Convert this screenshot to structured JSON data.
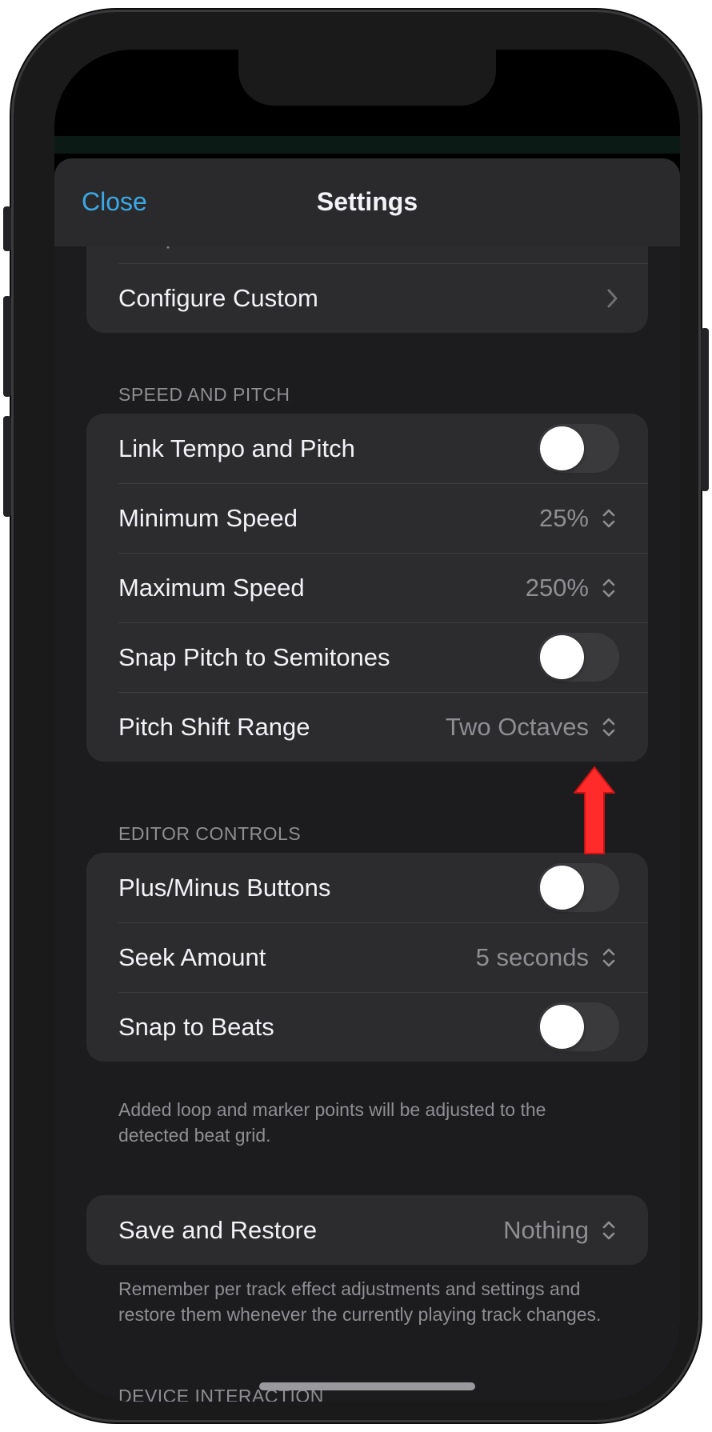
{
  "nav": {
    "close_label": "Close",
    "title": "Settings"
  },
  "top_group": {
    "partial_text": "Tempo, Pitch, Mono, Balance",
    "configure_label": "Configure Custom"
  },
  "speed_pitch": {
    "header": "SPEED AND PITCH",
    "rows": [
      {
        "label": "Link Tempo and Pitch",
        "kind": "toggle",
        "on": false
      },
      {
        "label": "Minimum Speed",
        "kind": "picker",
        "value": "25%"
      },
      {
        "label": "Maximum Speed",
        "kind": "picker",
        "value": "250%"
      },
      {
        "label": "Snap Pitch to Semitones",
        "kind": "toggle",
        "on": false
      },
      {
        "label": "Pitch Shift Range",
        "kind": "picker",
        "value": "Two Octaves"
      }
    ]
  },
  "editor_controls": {
    "header": "EDITOR CONTROLS",
    "rows": [
      {
        "label": "Plus/Minus Buttons",
        "kind": "toggle",
        "on": false
      },
      {
        "label": "Seek Amount",
        "kind": "picker",
        "value": "5 seconds"
      },
      {
        "label": "Snap to Beats",
        "kind": "toggle",
        "on": false
      }
    ],
    "footer": "Added loop and marker points will be adjusted to the detected beat grid."
  },
  "save_restore": {
    "label": "Save and Restore",
    "value": "Nothing",
    "footer": "Remember per track effect adjustments and settings and restore them whenever the currently playing track changes."
  },
  "next_section_partial": "DEVICE INTERACTION",
  "colors": {
    "accent": "#3aa9e6",
    "sheet_background": "#1c1c1e",
    "group_background": "#2c2c2e",
    "toggle_off": "#3a3a3c",
    "annotation_arrow": "#ff2a2a"
  },
  "icons": {
    "picker": "chevron-up-down-icon",
    "disclosure": "chevron-right-icon",
    "annotation": "red-up-arrow"
  }
}
